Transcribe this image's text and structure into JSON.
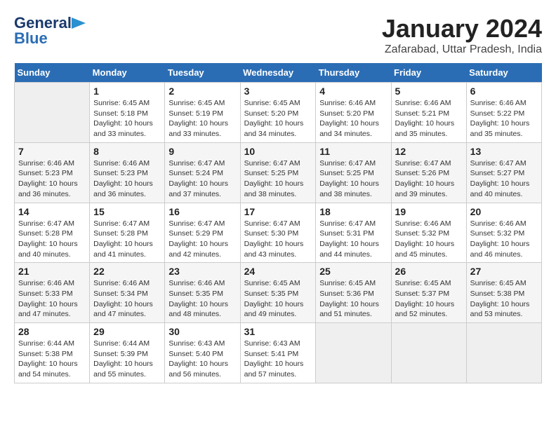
{
  "header": {
    "logo_line1": "General",
    "logo_line2": "Blue",
    "month_year": "January 2024",
    "location": "Zafarabad, Uttar Pradesh, India"
  },
  "columns": [
    "Sunday",
    "Monday",
    "Tuesday",
    "Wednesday",
    "Thursday",
    "Friday",
    "Saturday"
  ],
  "weeks": [
    [
      {
        "num": "",
        "empty": true
      },
      {
        "num": "1",
        "sunrise": "6:45 AM",
        "sunset": "5:18 PM",
        "daylight": "10 hours and 33 minutes."
      },
      {
        "num": "2",
        "sunrise": "6:45 AM",
        "sunset": "5:19 PM",
        "daylight": "10 hours and 33 minutes."
      },
      {
        "num": "3",
        "sunrise": "6:45 AM",
        "sunset": "5:20 PM",
        "daylight": "10 hours and 34 minutes."
      },
      {
        "num": "4",
        "sunrise": "6:46 AM",
        "sunset": "5:20 PM",
        "daylight": "10 hours and 34 minutes."
      },
      {
        "num": "5",
        "sunrise": "6:46 AM",
        "sunset": "5:21 PM",
        "daylight": "10 hours and 35 minutes."
      },
      {
        "num": "6",
        "sunrise": "6:46 AM",
        "sunset": "5:22 PM",
        "daylight": "10 hours and 35 minutes."
      }
    ],
    [
      {
        "num": "7",
        "sunrise": "6:46 AM",
        "sunset": "5:23 PM",
        "daylight": "10 hours and 36 minutes."
      },
      {
        "num": "8",
        "sunrise": "6:46 AM",
        "sunset": "5:23 PM",
        "daylight": "10 hours and 36 minutes."
      },
      {
        "num": "9",
        "sunrise": "6:47 AM",
        "sunset": "5:24 PM",
        "daylight": "10 hours and 37 minutes."
      },
      {
        "num": "10",
        "sunrise": "6:47 AM",
        "sunset": "5:25 PM",
        "daylight": "10 hours and 38 minutes."
      },
      {
        "num": "11",
        "sunrise": "6:47 AM",
        "sunset": "5:25 PM",
        "daylight": "10 hours and 38 minutes."
      },
      {
        "num": "12",
        "sunrise": "6:47 AM",
        "sunset": "5:26 PM",
        "daylight": "10 hours and 39 minutes."
      },
      {
        "num": "13",
        "sunrise": "6:47 AM",
        "sunset": "5:27 PM",
        "daylight": "10 hours and 40 minutes."
      }
    ],
    [
      {
        "num": "14",
        "sunrise": "6:47 AM",
        "sunset": "5:28 PM",
        "daylight": "10 hours and 40 minutes."
      },
      {
        "num": "15",
        "sunrise": "6:47 AM",
        "sunset": "5:28 PM",
        "daylight": "10 hours and 41 minutes."
      },
      {
        "num": "16",
        "sunrise": "6:47 AM",
        "sunset": "5:29 PM",
        "daylight": "10 hours and 42 minutes."
      },
      {
        "num": "17",
        "sunrise": "6:47 AM",
        "sunset": "5:30 PM",
        "daylight": "10 hours and 43 minutes."
      },
      {
        "num": "18",
        "sunrise": "6:47 AM",
        "sunset": "5:31 PM",
        "daylight": "10 hours and 44 minutes."
      },
      {
        "num": "19",
        "sunrise": "6:46 AM",
        "sunset": "5:32 PM",
        "daylight": "10 hours and 45 minutes."
      },
      {
        "num": "20",
        "sunrise": "6:46 AM",
        "sunset": "5:32 PM",
        "daylight": "10 hours and 46 minutes."
      }
    ],
    [
      {
        "num": "21",
        "sunrise": "6:46 AM",
        "sunset": "5:33 PM",
        "daylight": "10 hours and 47 minutes."
      },
      {
        "num": "22",
        "sunrise": "6:46 AM",
        "sunset": "5:34 PM",
        "daylight": "10 hours and 47 minutes."
      },
      {
        "num": "23",
        "sunrise": "6:46 AM",
        "sunset": "5:35 PM",
        "daylight": "10 hours and 48 minutes."
      },
      {
        "num": "24",
        "sunrise": "6:45 AM",
        "sunset": "5:35 PM",
        "daylight": "10 hours and 49 minutes."
      },
      {
        "num": "25",
        "sunrise": "6:45 AM",
        "sunset": "5:36 PM",
        "daylight": "10 hours and 51 minutes."
      },
      {
        "num": "26",
        "sunrise": "6:45 AM",
        "sunset": "5:37 PM",
        "daylight": "10 hours and 52 minutes."
      },
      {
        "num": "27",
        "sunrise": "6:45 AM",
        "sunset": "5:38 PM",
        "daylight": "10 hours and 53 minutes."
      }
    ],
    [
      {
        "num": "28",
        "sunrise": "6:44 AM",
        "sunset": "5:38 PM",
        "daylight": "10 hours and 54 minutes."
      },
      {
        "num": "29",
        "sunrise": "6:44 AM",
        "sunset": "5:39 PM",
        "daylight": "10 hours and 55 minutes."
      },
      {
        "num": "30",
        "sunrise": "6:43 AM",
        "sunset": "5:40 PM",
        "daylight": "10 hours and 56 minutes."
      },
      {
        "num": "31",
        "sunrise": "6:43 AM",
        "sunset": "5:41 PM",
        "daylight": "10 hours and 57 minutes."
      },
      {
        "num": "",
        "empty": true
      },
      {
        "num": "",
        "empty": true
      },
      {
        "num": "",
        "empty": true
      }
    ]
  ]
}
